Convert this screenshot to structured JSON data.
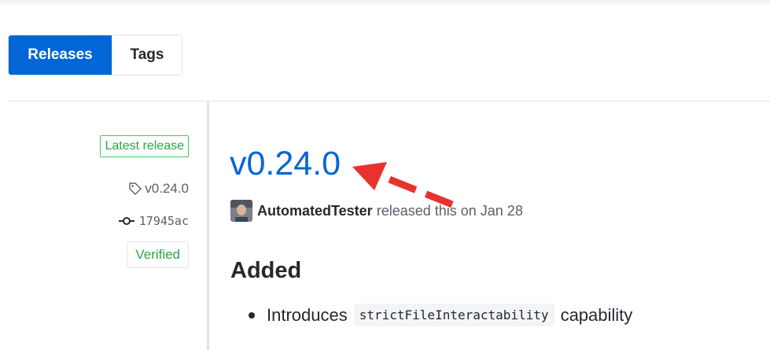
{
  "subnav": {
    "tabs": [
      {
        "label": "Releases",
        "selected": true
      },
      {
        "label": "Tags",
        "selected": false
      }
    ]
  },
  "sidebar_meta": {
    "latest_label": "Latest release",
    "tag_name": "v0.24.0",
    "commit_sha": "17945ac",
    "verified_label": "Verified"
  },
  "release": {
    "title": "v0.24.0",
    "author": "AutomatedTester",
    "released_text": "released this on Jan 28",
    "section_heading": "Added",
    "notes": [
      {
        "prefix": "Introduces",
        "code": "strictFileInteractability",
        "suffix": "capability"
      }
    ]
  },
  "colors": {
    "accent": "#0366d6",
    "success": "#28a745",
    "annotation_arrow": "#e8322d"
  },
  "icons": {
    "tag": "tag-icon",
    "commit": "git-commit-icon",
    "annotation": "red-dashed-arrow-icon"
  }
}
